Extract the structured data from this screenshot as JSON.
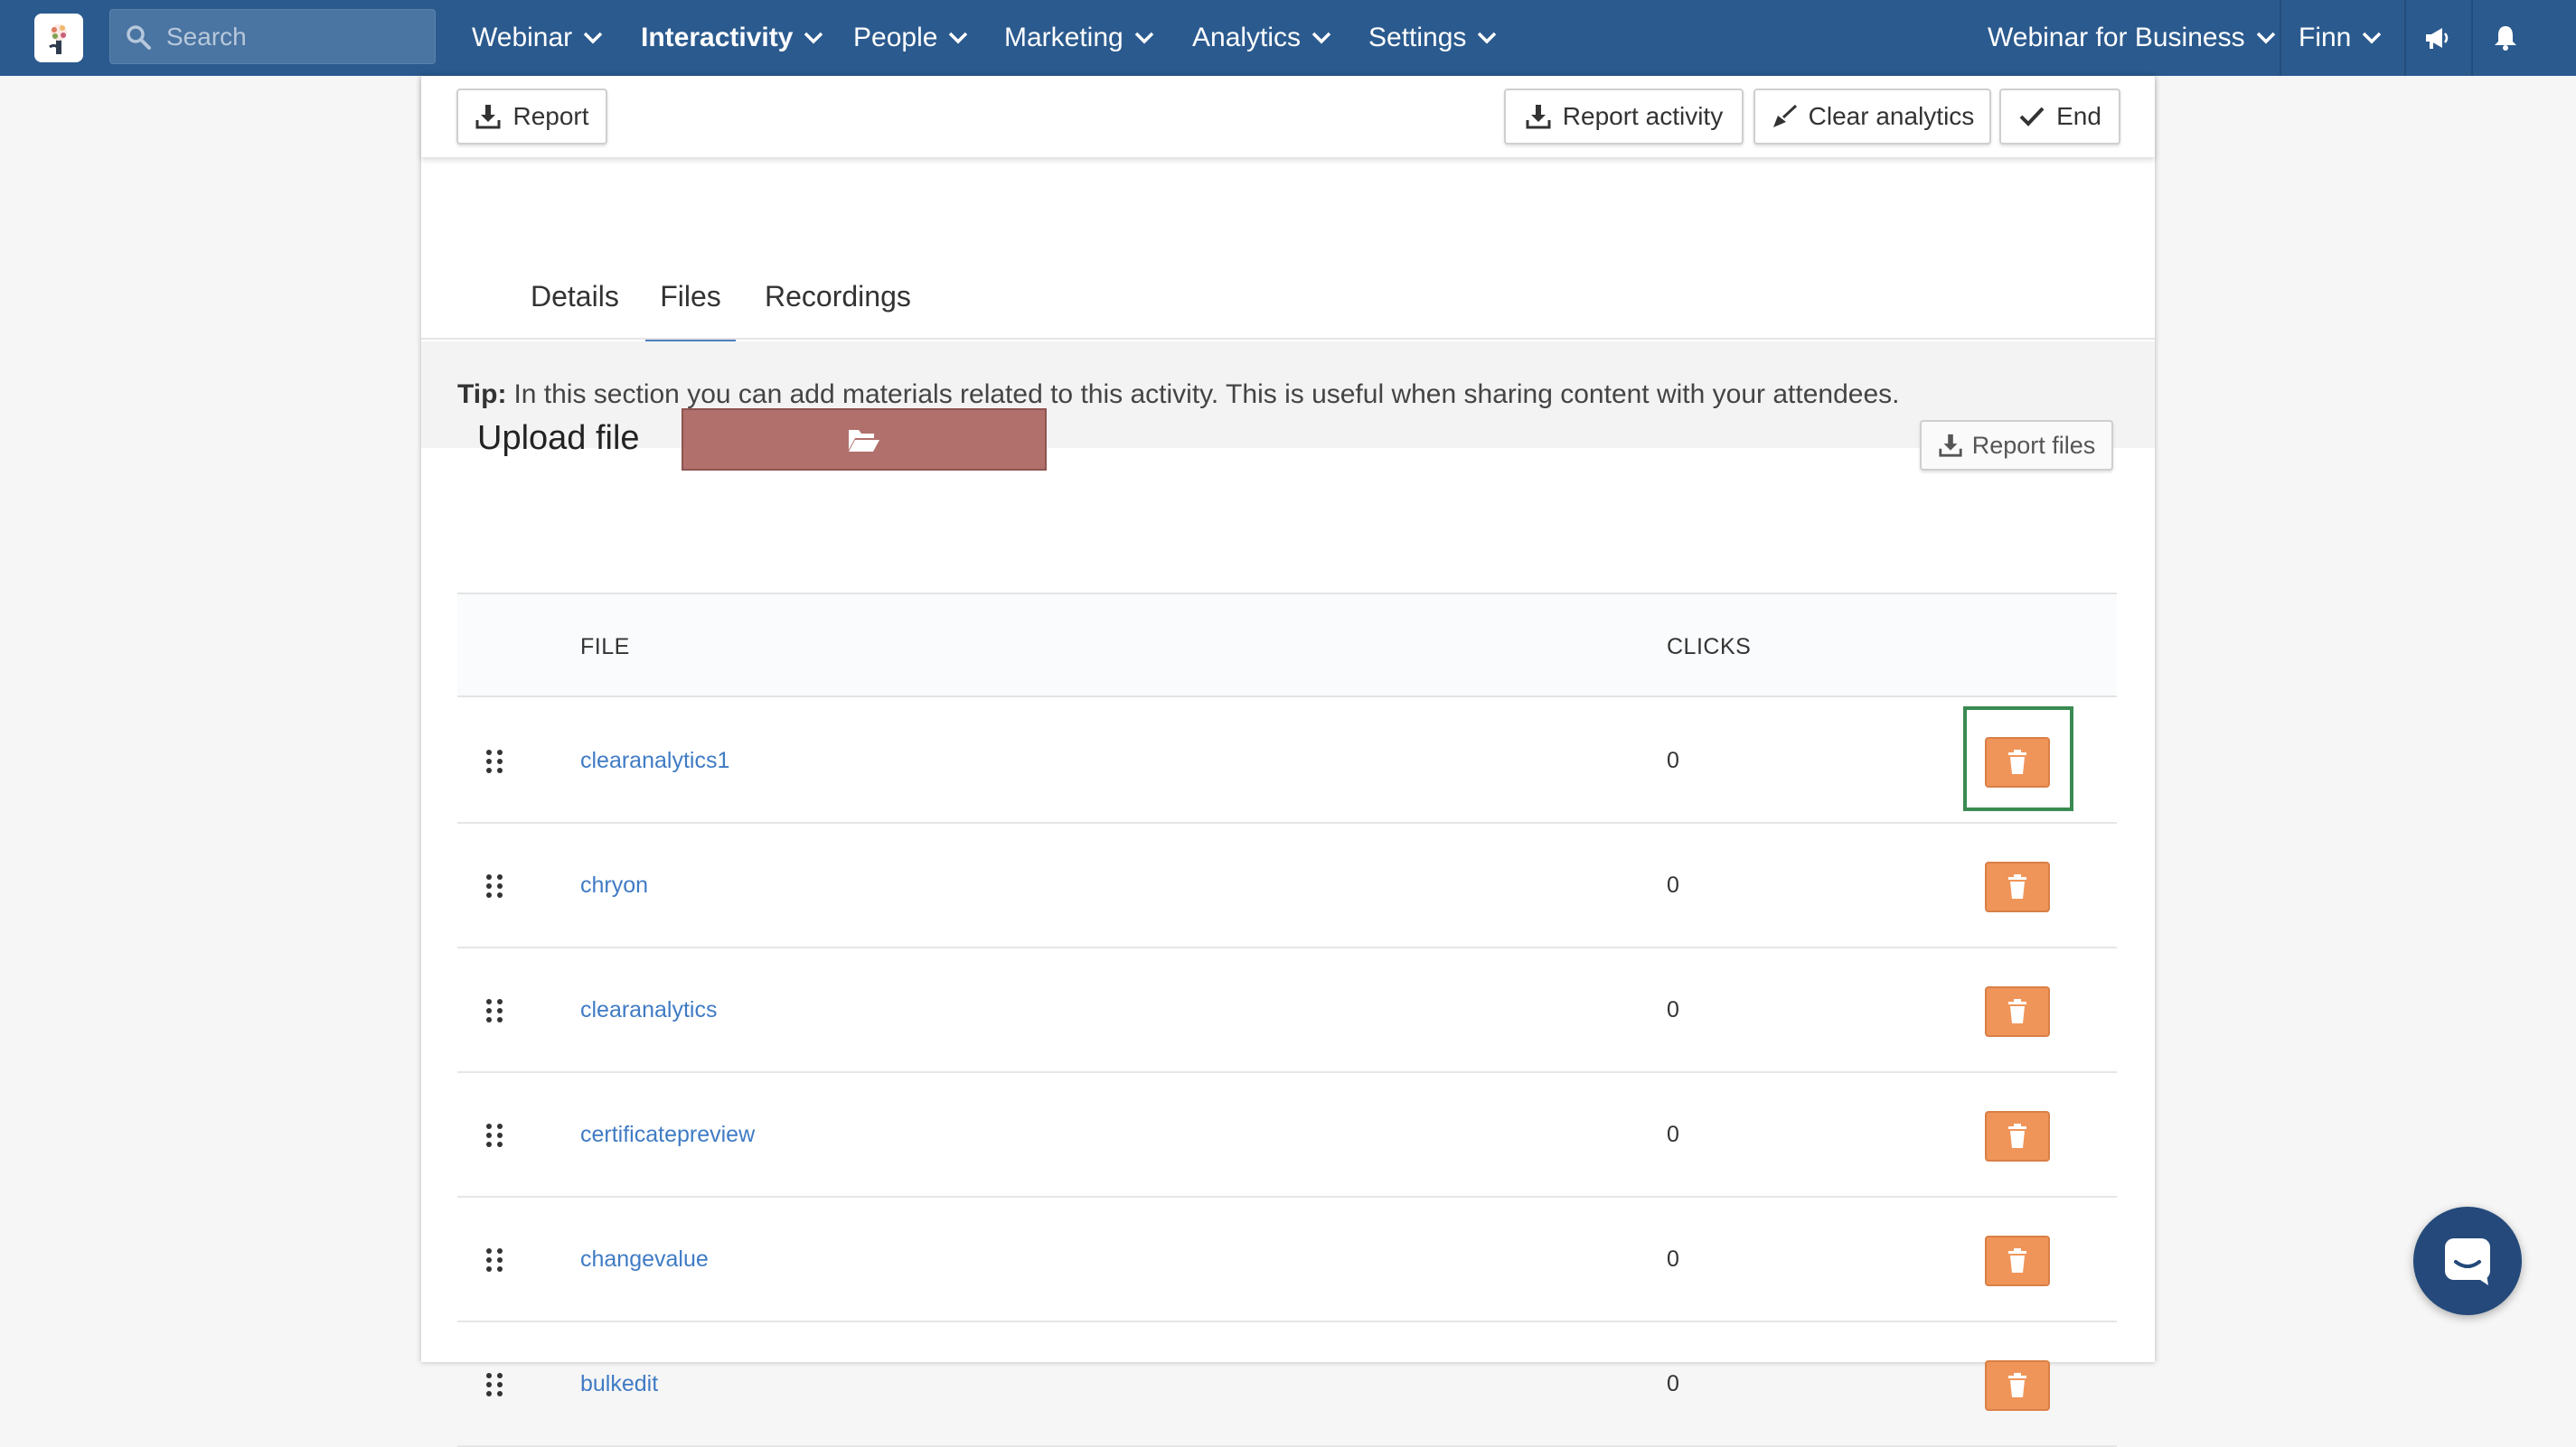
{
  "nav": {
    "search_placeholder": "Search",
    "items": [
      {
        "label": "Webinar"
      },
      {
        "label": "Interactivity"
      },
      {
        "label": "People"
      },
      {
        "label": "Marketing"
      },
      {
        "label": "Analytics"
      },
      {
        "label": "Settings"
      }
    ],
    "org": "Webinar for Business",
    "user": "Finn"
  },
  "toolbar": {
    "report": "Report",
    "report_activity": "Report activity",
    "clear_analytics": "Clear analytics",
    "end": "End"
  },
  "tabs": [
    {
      "label": "Details"
    },
    {
      "label": "Files"
    },
    {
      "label": "Recordings"
    }
  ],
  "tip": {
    "label": "Tip:",
    "text": "In this section you can add materials related to this activity. This is useful when sharing content with your attendees."
  },
  "upload": {
    "label": "Upload file",
    "report_files": "Report files"
  },
  "table": {
    "headers": {
      "file": "FILE",
      "clicks": "CLICKS"
    },
    "rows": [
      {
        "file": "clearanalytics1",
        "clicks": "0"
      },
      {
        "file": "chryon",
        "clicks": "0"
      },
      {
        "file": "clearanalytics",
        "clicks": "0"
      },
      {
        "file": "certificatepreview",
        "clicks": "0"
      },
      {
        "file": "changevalue",
        "clicks": "0"
      },
      {
        "file": "bulkedit",
        "clicks": "0"
      }
    ]
  },
  "colors": {
    "nav": "#2b5a8e",
    "upload_button": "#b1706c",
    "delete_button": "#f0955a",
    "link": "#3f7bc4",
    "highlight": "#3a8a52"
  },
  "icons": {
    "logo": "flower-logo-icon",
    "search": "search-icon",
    "chevron": "chevron-down-icon",
    "announce": "megaphone-icon",
    "notify": "bell-icon",
    "download": "download-icon",
    "broom": "broom-icon",
    "check": "check-icon",
    "folder": "folder-open-icon",
    "drag": "drag-handle-icon",
    "trash": "trash-icon",
    "chat": "chat-icon"
  }
}
